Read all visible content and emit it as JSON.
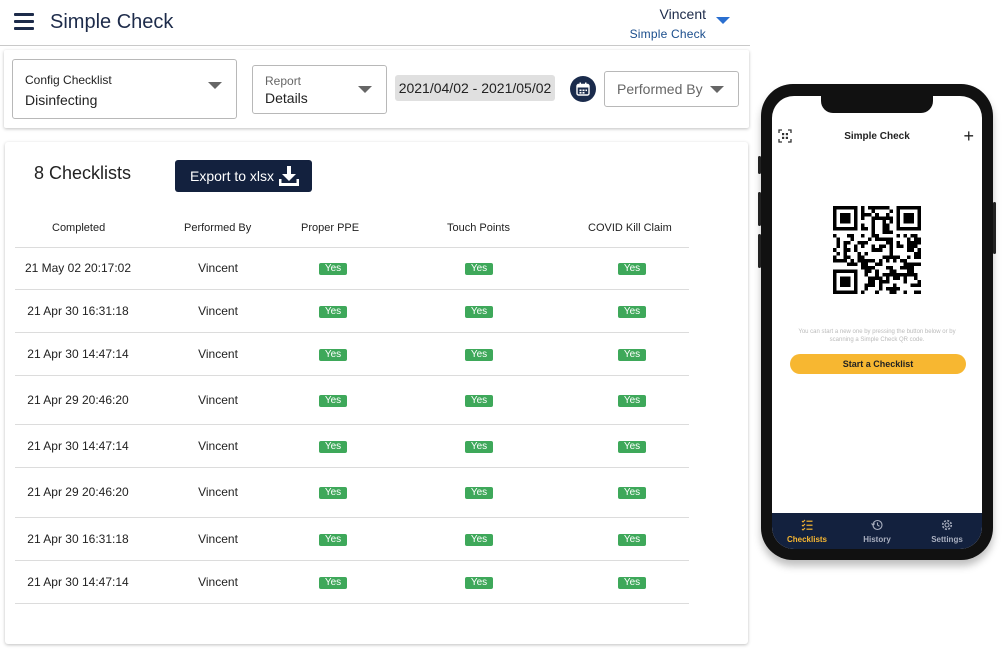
{
  "header": {
    "title": "Simple Check",
    "user_name": "Vincent",
    "user_org": "Simple Check"
  },
  "filters": {
    "config_label": "Config Checklist",
    "config_value": "Disinfecting",
    "report_label": "Report",
    "report_value": "Details",
    "date_range": "2021/04/02 - 2021/05/02",
    "performed_by_placeholder": "Performed By"
  },
  "main": {
    "count_title": "8 Checklists",
    "export_label": "Export to xlsx",
    "columns": [
      "Completed",
      "Performed By",
      "Proper PPE",
      "Touch Points",
      "COVID Kill Claim"
    ],
    "rows": [
      {
        "completed": "21 May 02 20:17:02",
        "performed_by": "Vincent",
        "ppe": "Yes",
        "touch": "Yes",
        "covid": "Yes"
      },
      {
        "completed": "21 Apr 30 16:31:18",
        "performed_by": "Vincent",
        "ppe": "Yes",
        "touch": "Yes",
        "covid": "Yes"
      },
      {
        "completed": "21 Apr 30 14:47:14",
        "performed_by": "Vincent",
        "ppe": "Yes",
        "touch": "Yes",
        "covid": "Yes"
      },
      {
        "completed": "21 Apr 29 20:46:20",
        "performed_by": "Vincent",
        "ppe": "Yes",
        "touch": "Yes",
        "covid": "Yes"
      },
      {
        "completed": "21 Apr 30 14:47:14",
        "performed_by": "Vincent",
        "ppe": "Yes",
        "touch": "Yes",
        "covid": "Yes"
      },
      {
        "completed": "21 Apr 29 20:46:20",
        "performed_by": "Vincent",
        "ppe": "Yes",
        "touch": "Yes",
        "covid": "Yes"
      },
      {
        "completed": "21 Apr 30 16:31:18",
        "performed_by": "Vincent",
        "ppe": "Yes",
        "touch": "Yes",
        "covid": "Yes"
      },
      {
        "completed": "21 Apr 30 14:47:14",
        "performed_by": "Vincent",
        "ppe": "Yes",
        "touch": "Yes",
        "covid": "Yes"
      }
    ]
  },
  "phone": {
    "title": "Simple Check",
    "hint": "You can start a new one by pressing the button below or by scanning a Simple Check QR code.",
    "start_button": "Start a Checklist",
    "nav": [
      "Checklists",
      "History",
      "Settings"
    ]
  },
  "colors": {
    "navy": "#13213e",
    "yes_green": "#3ea85a",
    "accent_yellow": "#f7b731",
    "link_blue": "#2a6fd0"
  },
  "icons": [
    "menu-icon",
    "chevron-down-icon",
    "calendar-icon",
    "download-icon",
    "scan-icon",
    "plus-icon",
    "qr-code-icon",
    "checklist-icon",
    "history-icon",
    "settings-icon"
  ]
}
